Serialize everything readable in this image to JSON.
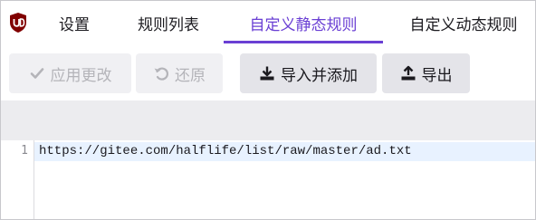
{
  "tabs": [
    {
      "label": "设置",
      "active": false
    },
    {
      "label": "规则列表",
      "active": false
    },
    {
      "label": "自定义静态规则",
      "active": true
    },
    {
      "label": "自定义动态规则",
      "active": false
    }
  ],
  "toolbar": {
    "apply_label": "应用更改",
    "revert_label": "还原",
    "import_label": "导入并添加",
    "export_label": "导出"
  },
  "icons": {
    "logo": "ublock-origin-logo",
    "apply": "check-icon",
    "revert": "undo-icon",
    "import": "import-icon",
    "export": "export-icon"
  },
  "colors": {
    "accent": "#6a3fd4",
    "logo": "#800000",
    "active_line": "#e8f2ff"
  },
  "editor": {
    "lines": [
      {
        "number": "1",
        "text": "https://gitee.com/halflife/list/raw/master/ad.txt"
      }
    ]
  }
}
